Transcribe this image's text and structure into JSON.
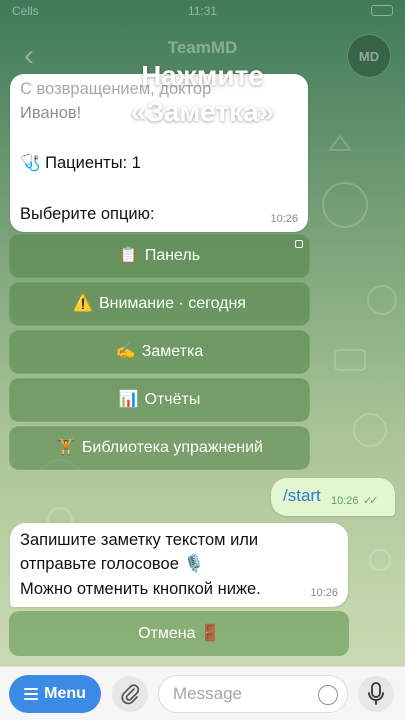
{
  "status_bar": {
    "carrier": "Cells",
    "time": "11:31"
  },
  "header": {
    "back_label": "‹",
    "title": "TeamMD",
    "avatar_text": "MD"
  },
  "tip": {
    "line1": "Нажмите",
    "line2": "«Заметка»"
  },
  "top_message": {
    "greeting_line1": "С возвращением, доктор",
    "greeting_line2": "Иванов!",
    "patients_icon": "🩺",
    "patients": "Пациенты: 1",
    "choose": "Выберите опцию:",
    "time": "10:26"
  },
  "keyboard": [
    {
      "icon": "📋",
      "label": "Панель"
    },
    {
      "icon": "⚠️",
      "label": "Внимание · сегодня"
    },
    {
      "icon": "✍️",
      "label": "Заметка"
    },
    {
      "icon": "📊",
      "label": "Отчёты"
    },
    {
      "icon": "🏋️",
      "label": "Библиотека упражнений"
    }
  ],
  "outgoing": {
    "text": "/start",
    "time": "10:26",
    "status_icon": "double-check-icon"
  },
  "note_message": {
    "line1": "Запишите заметку текстом или",
    "line2": "отправьте голосовое 🎙️",
    "line3": "Можно отменить кнопкой ниже.",
    "time": "10:26"
  },
  "cancel": {
    "label": "Отмена",
    "icon": "🚪"
  },
  "input_bar": {
    "menu_label": "Menu",
    "placeholder": "Message"
  },
  "colors": {
    "accent": "#3b8be6",
    "outgoing_bubble": "#e2f6cf",
    "button_bg": "#5f9650"
  }
}
